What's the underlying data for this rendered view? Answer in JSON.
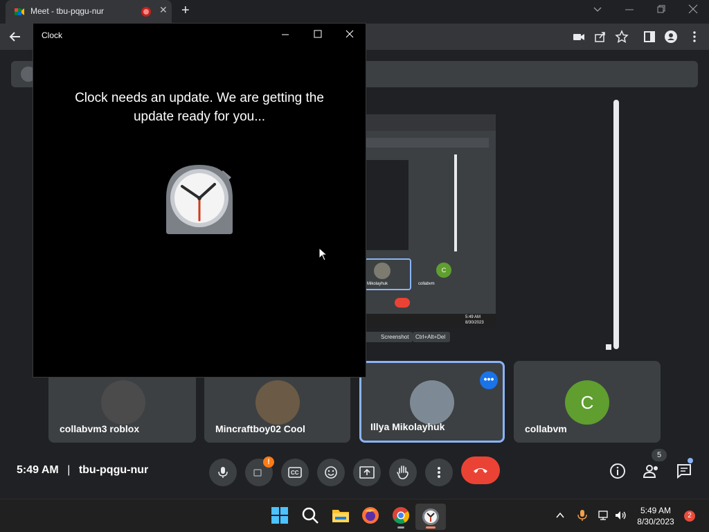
{
  "browser": {
    "tab_title": "Meet - tbu-pqgu-nur",
    "tab_close": "✕",
    "new_tab": "+"
  },
  "clock_window": {
    "title": "Clock",
    "message": "Clock needs an update. We are getting the update ready for you..."
  },
  "participants": [
    {
      "name": "collabvm3 roblox"
    },
    {
      "name": "Mincraftboy02 Cool"
    },
    {
      "name": "Illya Mikolayhuk"
    },
    {
      "name": "collabvm",
      "initial": "C"
    }
  ],
  "meeting": {
    "time": "5:49 AM",
    "separator": "|",
    "code": "tbu-pqgu-nur",
    "people_count": "5"
  },
  "presentation": {
    "inner_name_1": "Mikolayhuk",
    "inner_name_2": "collabvm",
    "inner_initial": "C",
    "btn_screenshot": "Screenshot",
    "btn_cad": "Ctrl+Alt+Del",
    "inner_time": "5:49 AM",
    "inner_date": "8/30/2023"
  },
  "taskbar": {
    "time": "5:49 AM",
    "date": "8/30/2023",
    "notification_count": "2"
  },
  "colors": {
    "accent_blue": "#8ab4f8",
    "end_call": "#ea4335",
    "collabvm_avatar": "#5f9e2f"
  }
}
